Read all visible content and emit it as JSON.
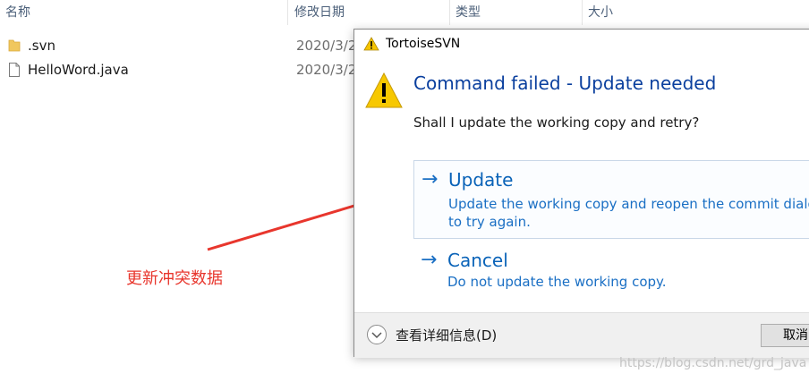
{
  "explorer": {
    "columns": [
      "名称",
      "修改日期",
      "类型",
      "大小"
    ],
    "files": [
      {
        "name": ".svn",
        "date": "2020/3/2",
        "icon": "folder-icon"
      },
      {
        "name": "HelloWord.java",
        "date": "2020/3/2",
        "icon": "file-icon"
      }
    ]
  },
  "annotation": {
    "text": "更新冲突数据",
    "color": "#e8362d"
  },
  "dialog": {
    "title": "TortoiseSVN",
    "main_instruction": "Command failed - Update needed",
    "content": "Shall I update the working copy and retry?",
    "commands": [
      {
        "arrow": "→",
        "title": "Update",
        "description": "Update the working copy and reopen the commit dialog to try again."
      },
      {
        "arrow": "→",
        "title": "Cancel",
        "description": "Do not update the working copy."
      }
    ],
    "details_label": "查看详细信息(D)",
    "cancel_button": "取消"
  },
  "watermark": "https://blog.csdn.net/grd_java",
  "colors": {
    "link": "#0a63b8",
    "instruction": "#0a3f9e",
    "warning": "#f5c400"
  }
}
